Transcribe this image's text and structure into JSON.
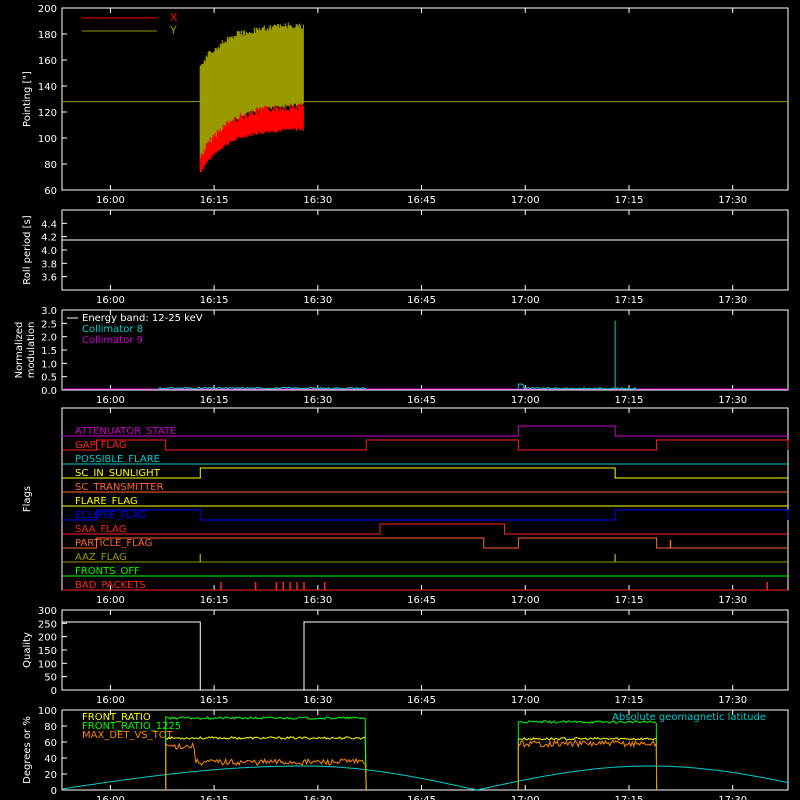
{
  "chart_data": [
    {
      "type": "line",
      "ylabel": "Pointing [\"]",
      "ylim": [
        60,
        200
      ],
      "yticks": [
        "60",
        "80",
        "100",
        "120",
        "140",
        "160",
        "180",
        "200"
      ],
      "xticks": [
        "16:00",
        "16:15",
        "16:30",
        "16:45",
        "17:00",
        "17:15",
        "17:30"
      ],
      "legend": [
        {
          "name": "X",
          "color": "#ff0000"
        },
        {
          "name": "Y",
          "color": "#999900"
        }
      ],
      "legend_position": "top-left",
      "series": [
        {
          "name": "X",
          "color": "#ff0000",
          "segment": [
            "16:13",
            "16:28"
          ],
          "start_range": [
            72,
            88
          ],
          "end_range": [
            106,
            128
          ]
        },
        {
          "name": "Y",
          "color": "#999900",
          "segment": [
            "16:13",
            "16:28"
          ],
          "start_range": [
            75,
            158
          ],
          "end_range": [
            125,
            190
          ]
        },
        {
          "name": "Y_level",
          "color": "#999900",
          "constant": 128
        }
      ]
    },
    {
      "type": "line",
      "ylabel": "Roll period [s]",
      "ylim": [
        3.4,
        4.6
      ],
      "yticks": [
        "3.6",
        "3.8",
        "4.0",
        "4.2",
        "4.4"
      ],
      "xticks": [
        "16:00",
        "16:15",
        "16:30",
        "16:45",
        "17:00",
        "17:15",
        "17:30"
      ],
      "series": [
        {
          "name": "roll",
          "color": "#ffffff",
          "constant": 4.15
        }
      ]
    },
    {
      "type": "line",
      "ylabel_lines": [
        "Normalized",
        "modulation"
      ],
      "ylim": [
        0,
        3.0
      ],
      "yticks": [
        "0.0",
        "0.5",
        "1.0",
        "1.5",
        "2.0",
        "2.5",
        "3.0"
      ],
      "xticks": [
        "16:00",
        "16:15",
        "16:30",
        "16:45",
        "17:00",
        "17:15",
        "17:30"
      ],
      "legend_position": "top-left",
      "legend": [
        {
          "name": "Energy band: 12-25 keV",
          "color": "#ffffff"
        },
        {
          "name": "Collimator 8",
          "color": "#00cccc"
        },
        {
          "name": "Collimator 9",
          "color": "#cc00cc"
        }
      ],
      "series": [
        {
          "name": "Collimator 9",
          "color": "#cc00cc",
          "constant": 0.0
        },
        {
          "name": "Collimator 8",
          "color": "#00cccc",
          "segments": [
            [
              "16:07",
              "16:37",
              0.07
            ],
            [
              "16:59",
              "17:16",
              0.06
            ]
          ],
          "spike": [
            "17:13",
            2.6
          ]
        }
      ]
    },
    {
      "type": "line",
      "ylabel": "Flags",
      "xticks": [
        "16:00",
        "16:15",
        "16:30",
        "16:45",
        "17:00",
        "17:15",
        "17:30"
      ],
      "flags": [
        {
          "name": "ATTENUATOR_STATE",
          "color": "#cc00cc",
          "high": [
            [
              "16:59",
              "17:13"
            ]
          ]
        },
        {
          "name": "GAP_FLAG",
          "color": "#ff2222",
          "high": [
            [
              "15:58",
              "16:08"
            ],
            [
              "16:37",
              "16:59"
            ],
            [
              "17:19",
              "17:38"
            ]
          ]
        },
        {
          "name": "POSSIBLE_FLARE",
          "color": "#00cccc",
          "high": []
        },
        {
          "name": "SC_IN_SUNLIGHT",
          "color": "#ffff00",
          "high": [
            [
              "16:13",
              "17:13"
            ]
          ]
        },
        {
          "name": "SC_TRANSMITTER",
          "color": "#ff6633",
          "high": []
        },
        {
          "name": "FLARE_FLAG",
          "color": "#ffff00",
          "high": []
        },
        {
          "name": "ECLIPSE_FLAG",
          "color": "#0000ff",
          "high": [
            [
              "15:58",
              "16:13"
            ],
            [
              "17:13",
              "17:38"
            ]
          ]
        },
        {
          "name": "SAA_FLAG",
          "color": "#ff2222",
          "high": [
            [
              "16:39",
              "16:57"
            ]
          ]
        },
        {
          "name": "PARTICLE_FLAG",
          "color": "#ff6633",
          "high": [
            [
              "15:58",
              "16:54"
            ],
            [
              "16:59",
              "17:19"
            ]
          ],
          "spikes": [
            "17:21"
          ]
        },
        {
          "name": "AAZ_FLAG",
          "color": "#999900",
          "high": [],
          "spikes": [
            "16:13",
            "17:13"
          ]
        },
        {
          "name": "FRONTS_OFF",
          "color": "#00ff00",
          "high": []
        },
        {
          "name": "BAD_PACKETS",
          "color": "#ff2222",
          "high": [],
          "spikes": [
            "16:16",
            "16:21",
            "16:24",
            "16:25",
            "16:26",
            "16:27",
            "16:28",
            "16:31",
            "17:35"
          ]
        }
      ]
    },
    {
      "type": "line",
      "ylabel": "Quality",
      "ylim": [
        0,
        300
      ],
      "yticks": [
        "0",
        "50",
        "100",
        "150",
        "200",
        "250",
        "300"
      ],
      "xticks": [
        "16:00",
        "16:15",
        "16:30",
        "16:45",
        "17:00",
        "17:15",
        "17:30"
      ],
      "series": [
        {
          "name": "Quality",
          "color": "#ffffff",
          "steps": [
            [
              "15:58",
              255
            ],
            [
              "16:13",
              0
            ],
            [
              "16:28",
              255
            ],
            [
              "17:38",
              255
            ]
          ]
        }
      ]
    },
    {
      "type": "line",
      "ylabel": "Degrees or %",
      "ylim": [
        0,
        100
      ],
      "yticks": [
        "0",
        "20",
        "40",
        "60",
        "80",
        "100"
      ],
      "xticks": [
        "16:00",
        "16:15",
        "16:30",
        "16:45",
        "17:00",
        "17:15",
        "17:30"
      ],
      "legend_position": "top-left",
      "legend": [
        {
          "name": "FRONT_RATIO",
          "color": "#ffff00"
        },
        {
          "name": "FRONT_RATIO_1225",
          "color": "#00ff00"
        },
        {
          "name": "MAX_DET_VS_TOT",
          "color": "#ff8800"
        }
      ],
      "legend_right": {
        "name": "Absolute geomagnetic latitude",
        "color": "#00cccc"
      },
      "series": [
        {
          "name": "FRONT_RATIO",
          "color": "#ffff00",
          "segments": [
            [
              "16:08",
              "16:37",
              65
            ],
            [
              "16:59",
              "17:19",
              64
            ]
          ]
        },
        {
          "name": "FRONT_RATIO_1225",
          "color": "#00ff00",
          "segments": [
            [
              "16:08",
              "16:37",
              90
            ],
            [
              "16:59",
              "17:19",
              85
            ]
          ]
        },
        {
          "name": "MAX_DET_VS_TOT",
          "color": "#ff8800",
          "segments": [
            [
              "16:08",
              "16:37",
              35
            ],
            [
              "16:59",
              "17:19",
              58
            ]
          ]
        },
        {
          "name": "Absolute geomagnetic latitude",
          "color": "#00cccc",
          "valleys": [
            "15:52",
            "16:53"
          ],
          "peaks": [
            "16:28",
            "17:18"
          ],
          "min": 0,
          "max": 30
        }
      ]
    }
  ]
}
